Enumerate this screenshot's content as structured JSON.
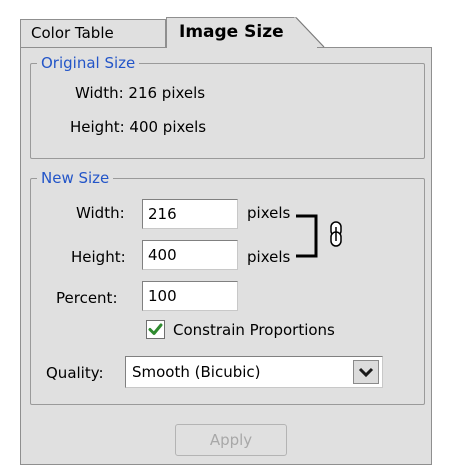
{
  "tabs": {
    "color_table": "Color Table",
    "image_size": "Image Size"
  },
  "original_size": {
    "legend": "Original Size",
    "width_text": "Width: 216 pixels",
    "height_text": "Height: 400 pixels"
  },
  "new_size": {
    "legend": "New Size",
    "width_label": "Width:",
    "width_value": "216",
    "width_unit": "pixels",
    "height_label": "Height:",
    "height_value": "400",
    "height_unit": "pixels",
    "percent_label": "Percent:",
    "percent_value": "100",
    "constrain_label": "Constrain Proportions",
    "constrain_checked": true,
    "quality_label": "Quality:",
    "quality_value": "Smooth (Bicubic)"
  },
  "actions": {
    "apply_label": "Apply",
    "apply_enabled": false
  },
  "colors": {
    "panel_bg": "#e0e0e0",
    "legend_text": "#2355c8",
    "check_green": "#2f8a2f",
    "disabled_text": "#a8a8a8"
  },
  "icons": {
    "link": "link-chain-icon",
    "check": "checkmark-icon",
    "dropdown": "chevron-down-icon"
  }
}
